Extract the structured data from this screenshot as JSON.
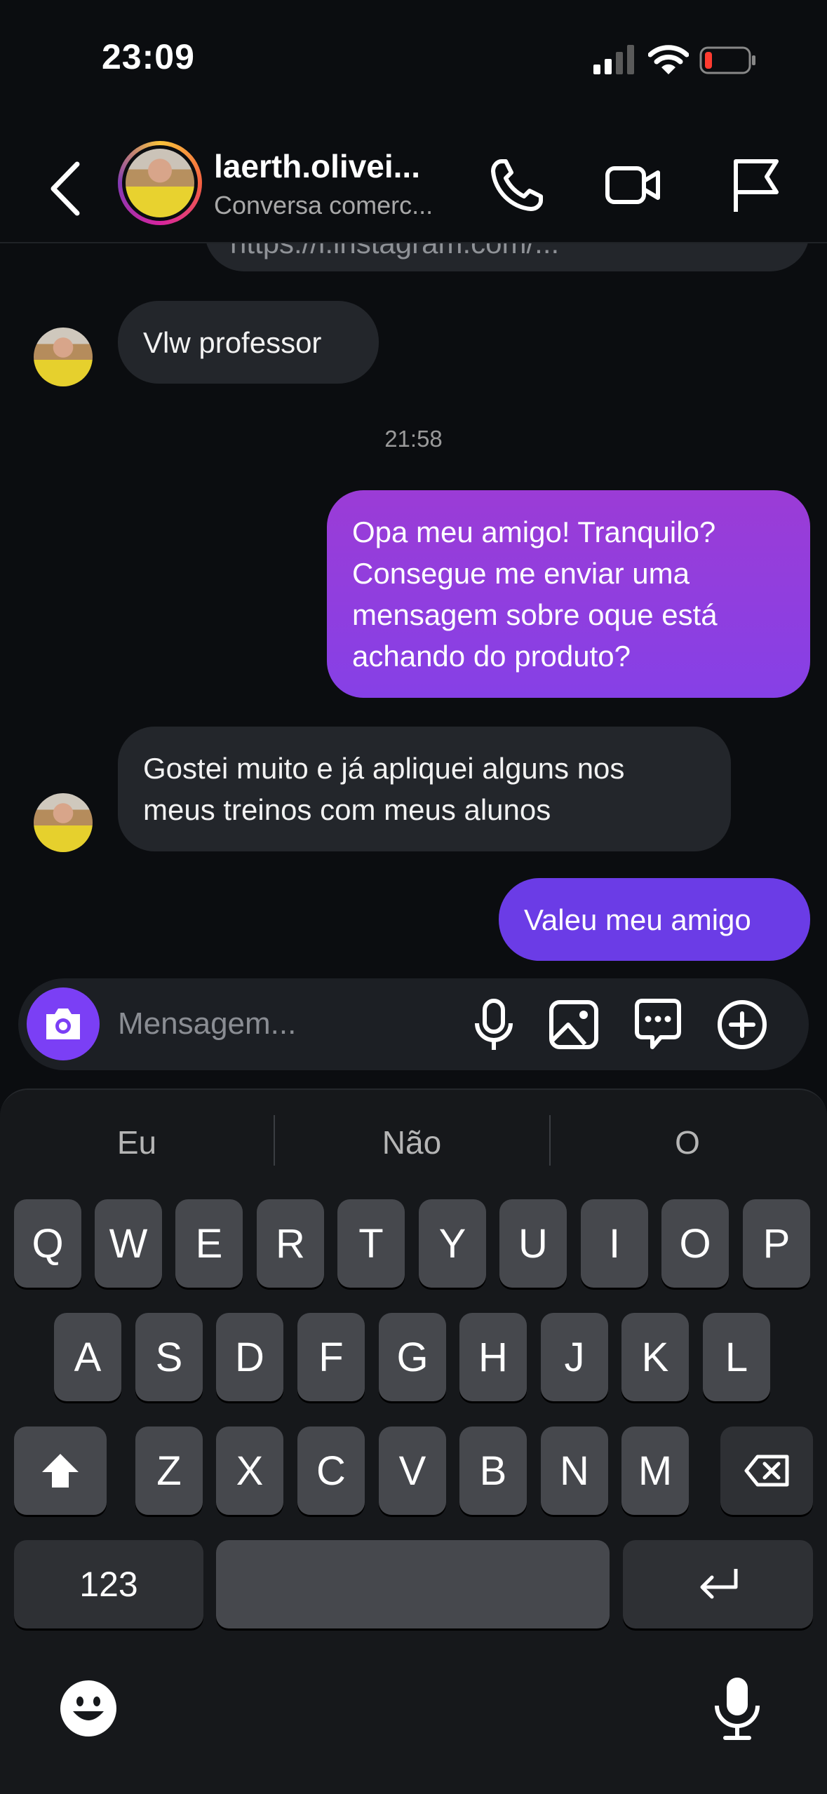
{
  "status_bar": {
    "time": "23:09"
  },
  "header": {
    "name": "laerth.olivei...",
    "subtitle": "Conversa comerc...",
    "icons": [
      "back-icon",
      "phone-icon",
      "video-icon",
      "flag-icon"
    ]
  },
  "chat": {
    "partial_link": "https://l.instagram.com/...",
    "timestamp": "21:58",
    "messages": [
      {
        "side": "incoming",
        "text": "Vlw professor"
      },
      {
        "side": "outgoing",
        "lines": [
          "Opa meu amigo! Tranquilo?",
          "Consegue me enviar uma",
          "mensagem sobre oque está",
          "achando do produto?"
        ]
      },
      {
        "side": "incoming",
        "lines": [
          "Gostei muito e já apliquei alguns nos",
          "meus treinos com meus alunos"
        ]
      },
      {
        "side": "outgoing",
        "text": "Valeu meu amigo"
      }
    ]
  },
  "composer": {
    "placeholder": "Mensagem...",
    "icons": [
      "camera-icon",
      "microphone-icon",
      "gallery-icon",
      "sticker-icon",
      "plus-icon"
    ]
  },
  "keyboard": {
    "suggestions": [
      "Eu",
      "Não",
      "O"
    ],
    "row1": [
      "Q",
      "W",
      "E",
      "R",
      "T",
      "Y",
      "U",
      "I",
      "O",
      "P"
    ],
    "row2": [
      "A",
      "S",
      "D",
      "F",
      "G",
      "H",
      "J",
      "K",
      "L"
    ],
    "row3": [
      "Z",
      "X",
      "C",
      "V",
      "B",
      "N",
      "M"
    ],
    "numbers_key": "123"
  }
}
